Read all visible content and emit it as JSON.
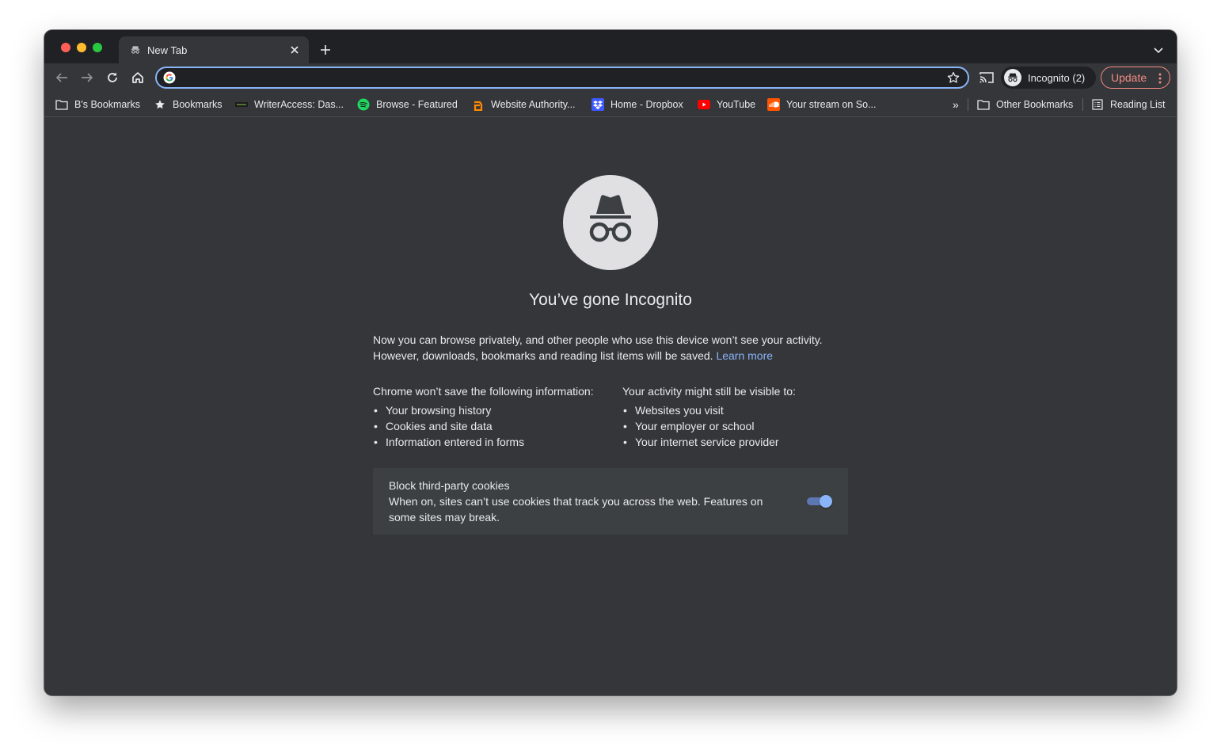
{
  "tab": {
    "title": "New Tab"
  },
  "omnibox": {
    "value": "",
    "placeholder": ""
  },
  "profile": {
    "label": "Incognito (2)"
  },
  "update": {
    "label": "Update"
  },
  "bookmarks": {
    "items": [
      {
        "label": "B's Bookmarks",
        "icon": "folder-icon"
      },
      {
        "label": "Bookmarks",
        "icon": "star-icon"
      },
      {
        "label": "WriterAccess: Das...",
        "icon": "writeraccess-icon"
      },
      {
        "label": "Browse - Featured",
        "icon": "spotify-icon"
      },
      {
        "label": "Website Authority...",
        "icon": "ahrefs-icon"
      },
      {
        "label": "Home - Dropbox",
        "icon": "dropbox-icon"
      },
      {
        "label": "YouTube",
        "icon": "youtube-icon"
      },
      {
        "label": "Your stream on So...",
        "icon": "soundcloud-icon"
      }
    ],
    "overflow": "»",
    "other": "Other Bookmarks",
    "reading_list": "Reading List"
  },
  "incognito": {
    "headline": "You’ve gone Incognito",
    "intro_1": "Now you can browse privately, and other people who use this device won’t see your activity.",
    "intro_2": "However, downloads, bookmarks and reading list items will be saved.",
    "learn_more": "Learn more",
    "left_head": "Chrome won’t save the following information:",
    "left_items": [
      "Your browsing history",
      "Cookies and site data",
      "Information entered in forms"
    ],
    "right_head": "Your activity might still be visible to:",
    "right_items": [
      "Websites you visit",
      "Your employer or school",
      "Your internet service provider"
    ],
    "cookie_title": "Block third-party cookies",
    "cookie_desc": "When on, sites can’t use cookies that track you across the web. Features on some sites may break.",
    "cookie_toggle_on": true
  },
  "colors": {
    "frame": "#202124",
    "toolbar": "#35363a",
    "accent": "#8ab4f8",
    "update": "#f28b82",
    "text": "#e8eaed"
  }
}
